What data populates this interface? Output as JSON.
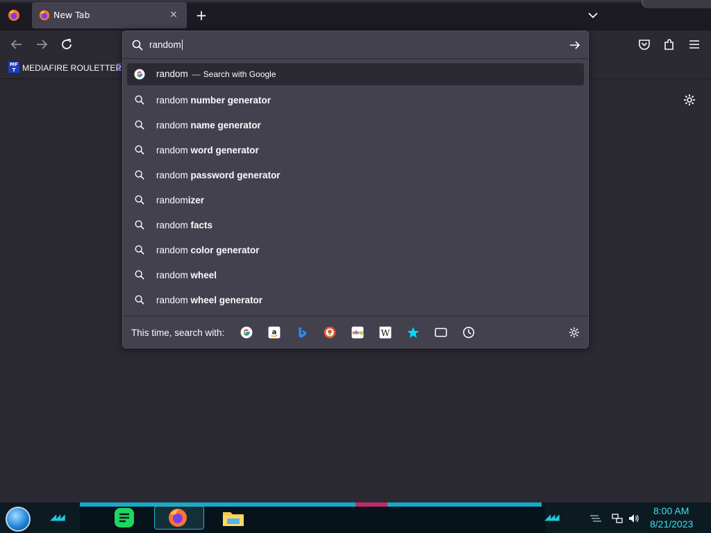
{
  "tab": {
    "title": "New Tab",
    "close_label": "×",
    "new_tab_label": "+"
  },
  "bookmarks": {
    "item_label": "MEDIAFIRE ROULETTER",
    "item_icon_text": "MF T"
  },
  "urlbar": {
    "value": "random",
    "heuristic": {
      "typed": "random",
      "separator": "—",
      "action": "Search with Google"
    },
    "suggestions": [
      {
        "typed": "random ",
        "completion": "number generator"
      },
      {
        "typed": "random ",
        "completion": "name generator"
      },
      {
        "typed": "random ",
        "completion": "word generator"
      },
      {
        "typed": "random ",
        "completion": "password generator"
      },
      {
        "typed": "random",
        "completion": "izer"
      },
      {
        "typed": "random ",
        "completion": "facts"
      },
      {
        "typed": "random ",
        "completion": "color generator"
      },
      {
        "typed": "random ",
        "completion": "wheel"
      },
      {
        "typed": "random ",
        "completion": "wheel generator"
      }
    ],
    "oneoff_label": "This time, search with:",
    "engines": [
      "google-icon",
      "amazon-icon",
      "bing-icon",
      "duckduckgo-icon",
      "ebay-icon",
      "wikipedia-icon",
      "bookmarks-icon",
      "tabs-icon",
      "history-icon"
    ]
  },
  "taskbar": {
    "time": "8:00 AM",
    "date": "8/21/2023"
  },
  "colors": {
    "accent": "#2fb5c9",
    "clock": "#3fe0f0",
    "panel": "#42414d",
    "background": "#2b2a33"
  }
}
